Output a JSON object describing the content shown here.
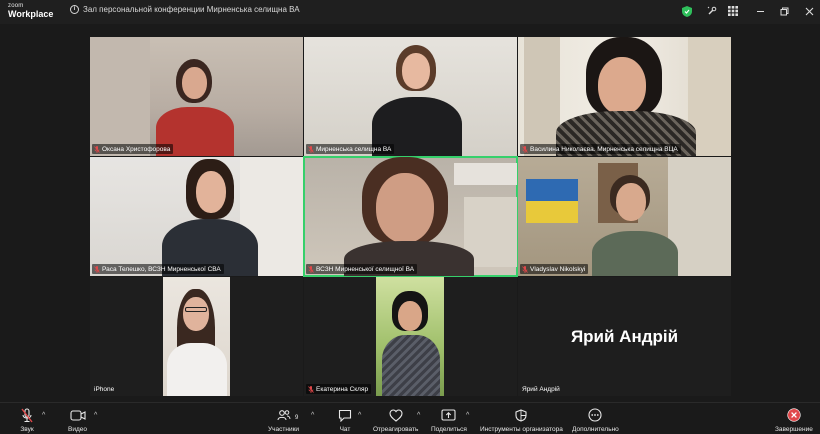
{
  "app": {
    "brand_top": "zoom",
    "brand_bottom": "Workplace"
  },
  "window": {
    "title": "Зал персональной конференции Мирненська селищна ВА"
  },
  "participants": [
    {
      "name": "Оксана Христофорова"
    },
    {
      "name": "Мирненська селищна ВА"
    },
    {
      "name": "Василина Николаєва. Мирненська селищна ВЦА"
    },
    {
      "name": "Раса Телешко, ВСЗН Мирненської СВА"
    },
    {
      "name": "ВСЗН Мирненської селищної  ВА",
      "active": true
    },
    {
      "name": "Vladyslav Nikolskyi"
    },
    {
      "name": "iPhone"
    },
    {
      "name": "Екатерина Скляр"
    },
    {
      "name": "Ярий Андрій",
      "avatar_text": "Ярий Андрій"
    }
  ],
  "toolbar": {
    "audio": "Звук",
    "video": "Видео",
    "participants": "Участники",
    "participants_count": "9",
    "chat": "Чат",
    "react": "Отреагировать",
    "share": "Поделиться",
    "host_tools": "Инструменты организатора",
    "more": "Дополнительно",
    "end": "Завершение"
  },
  "colors": {
    "active_speaker": "#36d06b",
    "end_button": "#e0484a",
    "shield": "#2fbf5b",
    "mute": "#e0484a"
  }
}
